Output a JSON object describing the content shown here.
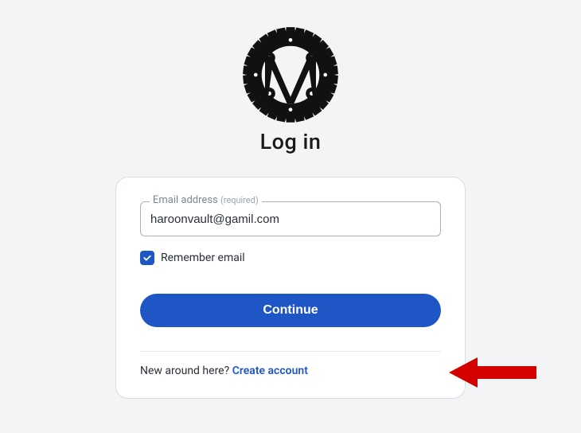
{
  "page": {
    "title": "Log in"
  },
  "form": {
    "email_label": "Email address ",
    "email_required_suffix": "(required)",
    "email_value": "haroonvault@gamil.com",
    "remember_label": "Remember email",
    "remember_checked": true,
    "continue_label": "Continue"
  },
  "signup": {
    "prompt": "New around here? ",
    "link_label": "Create account"
  },
  "colors": {
    "accent": "#1f56c5",
    "page_bg": "#f3f4f6",
    "border": "#d9dee3",
    "arrow": "#d40000"
  }
}
